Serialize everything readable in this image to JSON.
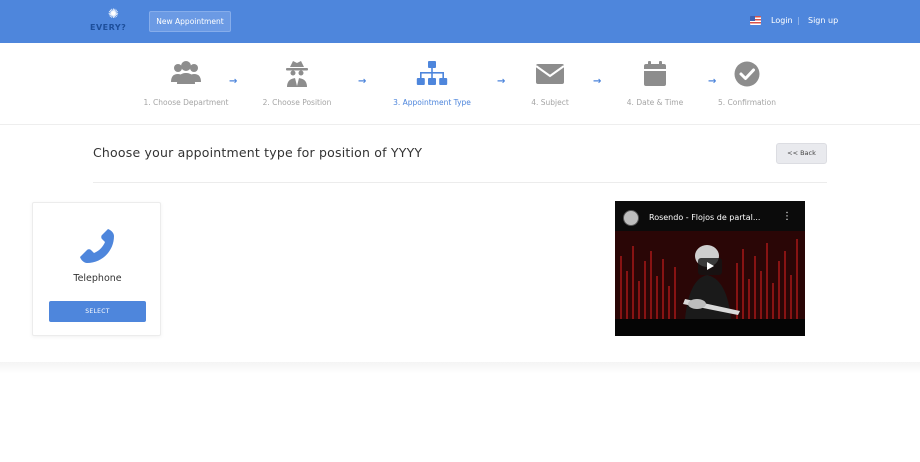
{
  "header": {
    "logo_text": "EVERY?",
    "new_appointment_label": "New Appointment",
    "login_label": "Login",
    "separator": "|",
    "signup_label": "Sign up"
  },
  "steps": [
    {
      "label": "1. Choose Department",
      "icon": "users-icon",
      "active": false
    },
    {
      "label": "2. Choose Position",
      "icon": "spy-icon",
      "active": false
    },
    {
      "label": "3. Appointment Type",
      "icon": "sitemap-icon",
      "active": true
    },
    {
      "label": "4. Subject",
      "icon": "envelope-icon",
      "active": false
    },
    {
      "label": "4. Date & Time",
      "icon": "calendar-icon",
      "active": false
    },
    {
      "label": "5. Confirmation",
      "icon": "check-circle-icon",
      "active": false
    }
  ],
  "step_arrow": "→",
  "main": {
    "heading": "Choose your appointment type for position of YYYY",
    "back_label": "<< Back"
  },
  "card": {
    "type_label": "Telephone",
    "select_label": "SELECT",
    "icon": "phone-icon"
  },
  "video": {
    "title": "Rosendo - Flojos de partal...",
    "menu_glyph": "⋮"
  },
  "colors": {
    "brand_blue": "#4e86dc",
    "step_inactive": "#a5a5a5",
    "icon_gray": "#8d8d8d"
  }
}
